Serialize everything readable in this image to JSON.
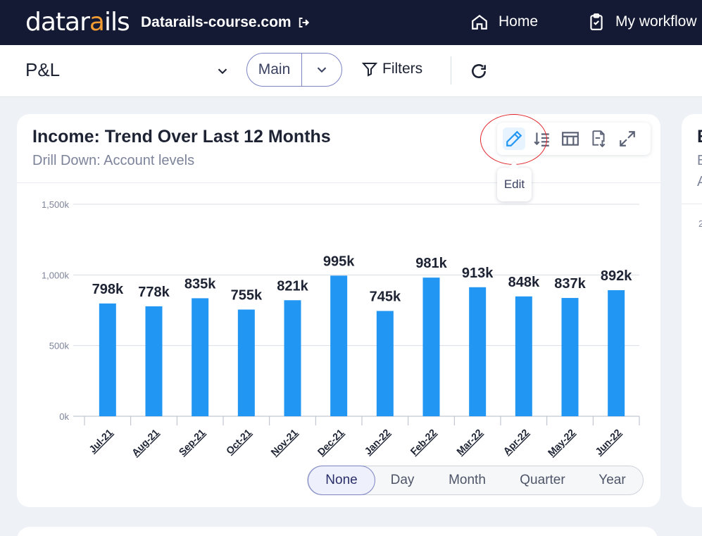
{
  "header": {
    "logo_main": "datar",
    "logo_accent": "a",
    "logo_rest": "ils",
    "company": "Datarails-course.com",
    "nav": [
      {
        "label": "Home",
        "icon": "home-icon"
      },
      {
        "label": "My workflow",
        "icon": "clipboard-check-icon"
      }
    ]
  },
  "filter_bar": {
    "report": "P&L",
    "scenario": "Main",
    "filters_label": "Filters"
  },
  "widget": {
    "title": "Income: Trend Over Last 12 Months",
    "subtitle": "Drill Down: Account levels",
    "toolbar": [
      "pencil-icon",
      "sort-icon",
      "table-icon",
      "pdf-export-icon",
      "expand-icon"
    ],
    "tooltip": "Edit",
    "granularity": {
      "options": [
        "None",
        "Day",
        "Month",
        "Quarter",
        "Year"
      ],
      "selected": "None"
    }
  },
  "chart_data": {
    "type": "bar",
    "categories": [
      "Jul-21",
      "Aug-21",
      "Sep-21",
      "Oct-21",
      "Nov-21",
      "Dec-21",
      "Jan-22",
      "Feb-22",
      "Mar-22",
      "Apr-22",
      "May-22",
      "Jun-22"
    ],
    "values": [
      798,
      778,
      835,
      755,
      821,
      995,
      745,
      981,
      913,
      848,
      837,
      892
    ],
    "data_labels": [
      "798k",
      "778k",
      "835k",
      "755k",
      "821k",
      "995k",
      "745k",
      "981k",
      "913k",
      "848k",
      "837k",
      "892k"
    ],
    "y_ticks": [
      0,
      500,
      1000,
      1500
    ],
    "y_tick_labels": [
      "0k",
      "500k",
      "1,000k",
      "1,500k"
    ],
    "ylim": [
      0,
      1500
    ],
    "bar_color": "#2196f3",
    "grid": true
  },
  "side_widget": {
    "title_fragment": "E",
    "line1_fragment": "E",
    "line2_fragment": "A",
    "tick_fragment": "2"
  },
  "colors": {
    "topbar": "#141a33",
    "accent": "#f39c33",
    "bar": "#2196f3",
    "highlight_circle": "#e2232a"
  }
}
